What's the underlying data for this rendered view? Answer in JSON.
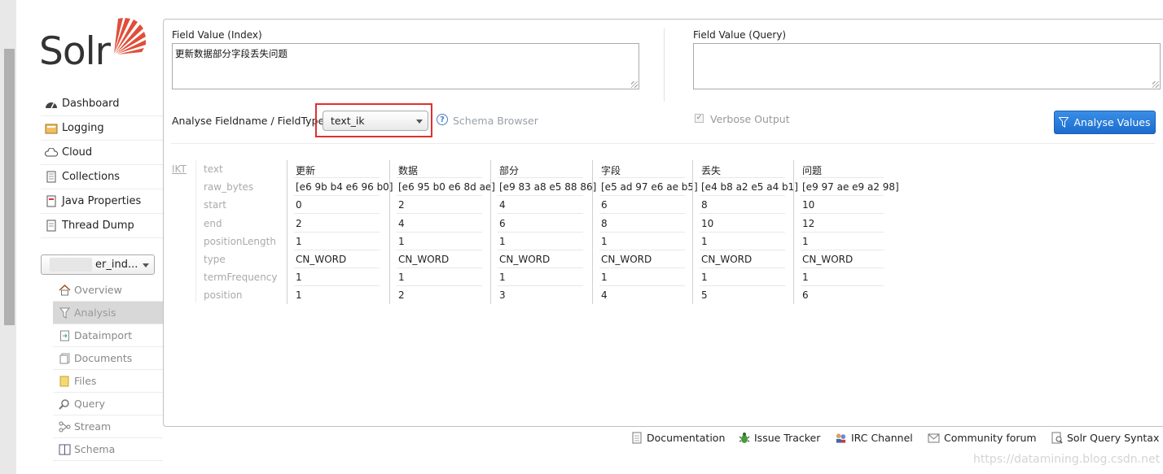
{
  "app": {
    "logo_text": "Solr"
  },
  "nav": {
    "items": [
      {
        "label": "Dashboard",
        "icon": "dashboard-icon"
      },
      {
        "label": "Logging",
        "icon": "logging-icon"
      },
      {
        "label": "Cloud",
        "icon": "cloud-icon"
      },
      {
        "label": "Collections",
        "icon": "collections-icon"
      },
      {
        "label": "Java Properties",
        "icon": "java-icon"
      },
      {
        "label": "Thread Dump",
        "icon": "thread-dump-icon"
      }
    ]
  },
  "core_selector": {
    "value": "er_ind..."
  },
  "core_menu": {
    "items": [
      {
        "label": "Overview",
        "icon": "home-icon",
        "active": false
      },
      {
        "label": "Analysis",
        "icon": "filter-icon",
        "active": true
      },
      {
        "label": "Dataimport",
        "icon": "dataimport-icon",
        "active": false
      },
      {
        "label": "Documents",
        "icon": "documents-icon",
        "active": false
      },
      {
        "label": "Files",
        "icon": "files-icon",
        "active": false
      },
      {
        "label": "Query",
        "icon": "query-icon",
        "active": false
      },
      {
        "label": "Stream",
        "icon": "stream-icon",
        "active": false
      },
      {
        "label": "Schema",
        "icon": "schema-icon",
        "active": false
      }
    ]
  },
  "analysis": {
    "index_label": "Field Value (Index)",
    "index_value": "更新数据部分字段丢失问题",
    "query_label": "Field Value (Query)",
    "query_value": "",
    "fieldtype_label": "Analyse Fieldname / FieldType:",
    "fieldtype_value": "text_ik",
    "schema_browser": "Schema Browser",
    "verbose_label": "Verbose Output",
    "verbose_checked": true,
    "analyse_button": "Analyse Values"
  },
  "result": {
    "tokenizer": "IKT",
    "row_labels": [
      "text",
      "raw_bytes",
      "start",
      "end",
      "positionLength",
      "type",
      "termFrequency",
      "position"
    ],
    "tokens": [
      [
        "更新",
        "[e6 9b b4 e6 96 b0]",
        "0",
        "2",
        "1",
        "CN_WORD",
        "1",
        "1"
      ],
      [
        "数据",
        "[e6 95 b0 e6 8d ae]",
        "2",
        "4",
        "1",
        "CN_WORD",
        "1",
        "2"
      ],
      [
        "部分",
        "[e9 83 a8 e5 88 86]",
        "4",
        "6",
        "1",
        "CN_WORD",
        "1",
        "3"
      ],
      [
        "字段",
        "[e5 ad 97 e6 ae b5]",
        "6",
        "8",
        "1",
        "CN_WORD",
        "1",
        "4"
      ],
      [
        "丢失",
        "[e4 b8 a2 e5 a4 b1]",
        "8",
        "10",
        "1",
        "CN_WORD",
        "1",
        "5"
      ],
      [
        "问题",
        "[e9 97 ae e9 a2 98]",
        "10",
        "12",
        "1",
        "CN_WORD",
        "1",
        "6"
      ]
    ]
  },
  "footer": {
    "links": [
      {
        "label": "Documentation",
        "icon": "document-icon"
      },
      {
        "label": "Issue Tracker",
        "icon": "bug-icon"
      },
      {
        "label": "IRC Channel",
        "icon": "irc-icon"
      },
      {
        "label": "Community forum",
        "icon": "mail-icon"
      },
      {
        "label": "Solr Query Syntax",
        "icon": "query-syntax-icon"
      }
    ]
  },
  "watermark": "https://datamining.blog.csdn.net",
  "colors": {
    "accent": "#2a7ddb",
    "highlight_border": "#e03030",
    "logo_red": "#e04e39"
  }
}
